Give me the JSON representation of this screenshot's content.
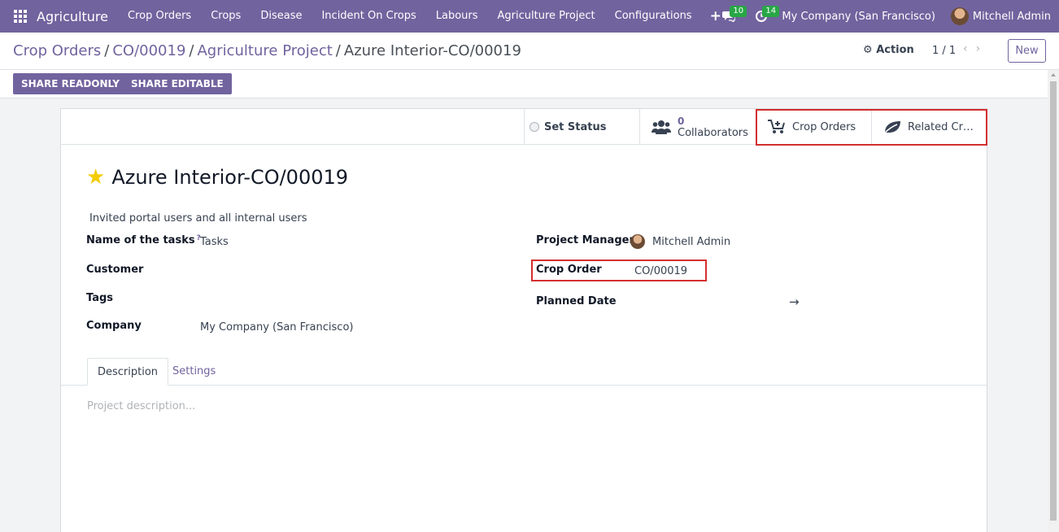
{
  "navbar": {
    "app_name": "Agriculture",
    "menu": [
      "Crop Orders",
      "Crops",
      "Disease",
      "Incident On Crops",
      "Labours",
      "Agriculture Project",
      "Configurations"
    ],
    "messages_count": "10",
    "activities_count": "14",
    "company": "My Company (San Francisco)",
    "user": "Mitchell Admin",
    "color": "#71639e"
  },
  "breadcrumb": {
    "items": [
      "Crop Orders",
      "CO/00019",
      "Agriculture Project"
    ],
    "current": "Azure Interior-CO/00019"
  },
  "control": {
    "action_label": "Action",
    "pager": "1 / 1",
    "new_label": "New"
  },
  "share": {
    "readonly_label": "SHARE READONLY",
    "editable_label": "SHARE EDITABLE"
  },
  "smart_buttons": {
    "set_status": "Set Status",
    "collaborators_count": "0",
    "collaborators_label": "Collaborators",
    "crop_orders": "Crop Orders",
    "related_crops": "Related Cr…"
  },
  "record": {
    "title": "Azure Interior-CO/00019",
    "privacy": "Invited portal users and all internal users"
  },
  "fields": {
    "tasks_label": "Name of the tasks",
    "tasks_help": "?",
    "tasks_value": "Tasks",
    "customer_label": "Customer",
    "tags_label": "Tags",
    "company_label": "Company",
    "company_value": "My Company (San Francisco)",
    "manager_label": "Project Manager",
    "manager_value": "Mitchell Admin",
    "crop_order_label": "Crop Order",
    "crop_order_value": "CO/00019",
    "planned_date_label": "Planned Date",
    "planned_date_arrow": "→"
  },
  "tabs": {
    "description": "Description",
    "settings": "Settings",
    "description_placeholder": "Project description..."
  },
  "highlight_color": "#d32f2f"
}
